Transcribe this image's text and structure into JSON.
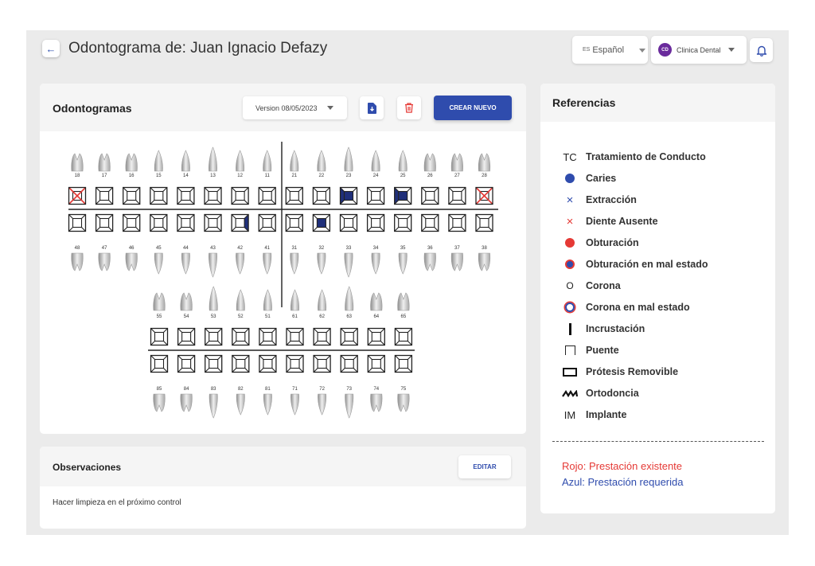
{
  "header": {
    "back_glyph": "←",
    "title": "Odontograma de: Juan Ignacio Defazy"
  },
  "language": {
    "code": "ES",
    "label": "Español"
  },
  "clinic": {
    "initials": "CD",
    "label": "Clinica Dental"
  },
  "odontogram": {
    "title": "Odontogramas",
    "version": "Version 08/05/2023",
    "create_label": "CREAR NUEVO",
    "upper_adult": [
      {
        "n": "18",
        "mark": "absent"
      },
      {
        "n": "17"
      },
      {
        "n": "16"
      },
      {
        "n": "15"
      },
      {
        "n": "14"
      },
      {
        "n": "13"
      },
      {
        "n": "12"
      },
      {
        "n": "11"
      },
      {
        "n": "21"
      },
      {
        "n": "22"
      },
      {
        "n": "23",
        "mark": "blue-left"
      },
      {
        "n": "24"
      },
      {
        "n": "25",
        "mark": "blue-left"
      },
      {
        "n": "26"
      },
      {
        "n": "27"
      },
      {
        "n": "28",
        "mark": "absent"
      }
    ],
    "lower_adult": [
      {
        "n": "48"
      },
      {
        "n": "47"
      },
      {
        "n": "46"
      },
      {
        "n": "45"
      },
      {
        "n": "44"
      },
      {
        "n": "43"
      },
      {
        "n": "42",
        "mark": "blue-right"
      },
      {
        "n": "41"
      },
      {
        "n": "31"
      },
      {
        "n": "32",
        "mark": "blue-center"
      },
      {
        "n": "33"
      },
      {
        "n": "34"
      },
      {
        "n": "35"
      },
      {
        "n": "36"
      },
      {
        "n": "37"
      },
      {
        "n": "38"
      }
    ],
    "upper_child": [
      "55",
      "54",
      "53",
      "52",
      "51",
      "61",
      "62",
      "63",
      "64",
      "65"
    ],
    "lower_child": [
      "85",
      "84",
      "83",
      "82",
      "81",
      "71",
      "72",
      "73",
      "74",
      "75"
    ]
  },
  "observations": {
    "title": "Observaciones",
    "edit_label": "EDITAR",
    "text": "Hacer limpieza en el próximo control"
  },
  "references": {
    "title": "Referencias",
    "items": [
      {
        "symbol": "tc",
        "symbol_text": "TC",
        "label": "Tratamiento de Conducto"
      },
      {
        "symbol": "dot-blue",
        "label": "Caries"
      },
      {
        "symbol": "x-blue",
        "symbol_text": "×",
        "label": "Extracción"
      },
      {
        "symbol": "x-red",
        "symbol_text": "×",
        "label": "Diente Ausente"
      },
      {
        "symbol": "dot-red",
        "label": "Obturación"
      },
      {
        "symbol": "dot-redblue",
        "label": "Obturación en mal estado"
      },
      {
        "symbol": "ring",
        "symbol_text": "O",
        "label": "Corona"
      },
      {
        "symbol": "ring-bad",
        "label": "Corona en mal estado"
      },
      {
        "symbol": "bar",
        "label": "Incrustación"
      },
      {
        "symbol": "bridge",
        "label": "Puente"
      },
      {
        "symbol": "rect",
        "label": "Prótesis Removible"
      },
      {
        "symbol": "zigzag",
        "label": "Ortodoncia"
      },
      {
        "symbol": "im",
        "symbol_text": "IM",
        "label": "Implante"
      }
    ],
    "red_note": "Rojo: Prestación existente",
    "blue_note": "Azul: Prestación requerida"
  },
  "colors": {
    "primary": "#2f4cad",
    "fill_blue": "#1f2f7a",
    "red": "#e53935",
    "purple": "#6a2b9c"
  }
}
